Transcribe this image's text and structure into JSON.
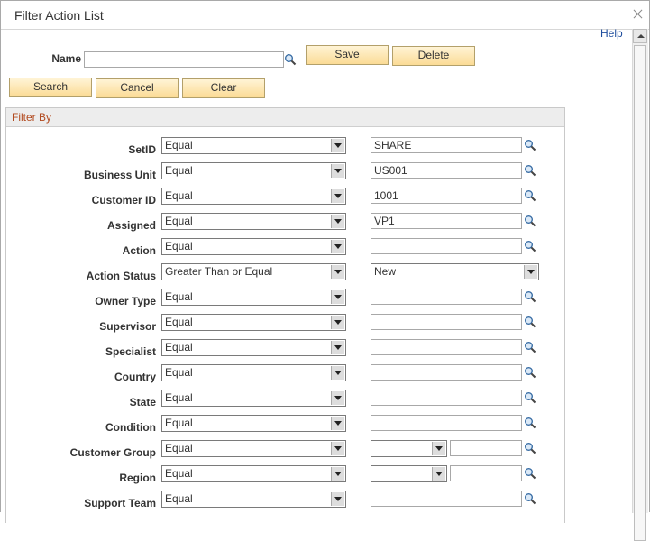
{
  "dialog": {
    "title": "Filter Action List",
    "help_label": "Help"
  },
  "top": {
    "name_label": "Name",
    "name_value": "",
    "save_label": "Save",
    "delete_label": "Delete",
    "search_label": "Search",
    "cancel_label": "Cancel",
    "clear_label": "Clear"
  },
  "filter": {
    "section_title": "Filter By",
    "rows": [
      {
        "label": "SetID",
        "operator": "Equal",
        "value": "SHARE",
        "kind": "text"
      },
      {
        "label": "Business Unit",
        "operator": "Equal",
        "value": "US001",
        "kind": "text"
      },
      {
        "label": "Customer ID",
        "operator": "Equal",
        "value": "1001",
        "kind": "text"
      },
      {
        "label": "Assigned",
        "operator": "Equal",
        "value": "VP1",
        "kind": "text"
      },
      {
        "label": "Action",
        "operator": "Equal",
        "value": "",
        "kind": "text"
      },
      {
        "label": "Action Status",
        "operator": "Greater Than or Equal",
        "value": "New",
        "kind": "select"
      },
      {
        "label": "Owner Type",
        "operator": "Equal",
        "value": "",
        "kind": "text"
      },
      {
        "label": "Supervisor",
        "operator": "Equal",
        "value": "",
        "kind": "text"
      },
      {
        "label": "Specialist",
        "operator": "Equal",
        "value": "",
        "kind": "text"
      },
      {
        "label": "Country",
        "operator": "Equal",
        "value": "",
        "kind": "text"
      },
      {
        "label": "State",
        "operator": "Equal",
        "value": "",
        "kind": "text"
      },
      {
        "label": "Condition",
        "operator": "Equal",
        "value": "",
        "kind": "text"
      },
      {
        "label": "Customer Group",
        "operator": "Equal",
        "value": "",
        "kind": "split"
      },
      {
        "label": "Region",
        "operator": "Equal",
        "value": "",
        "kind": "split"
      },
      {
        "label": "Support Team",
        "operator": "Equal",
        "value": "",
        "kind": "text"
      }
    ]
  },
  "icons": {
    "lookup": "magnifier-icon",
    "close": "close-icon"
  }
}
